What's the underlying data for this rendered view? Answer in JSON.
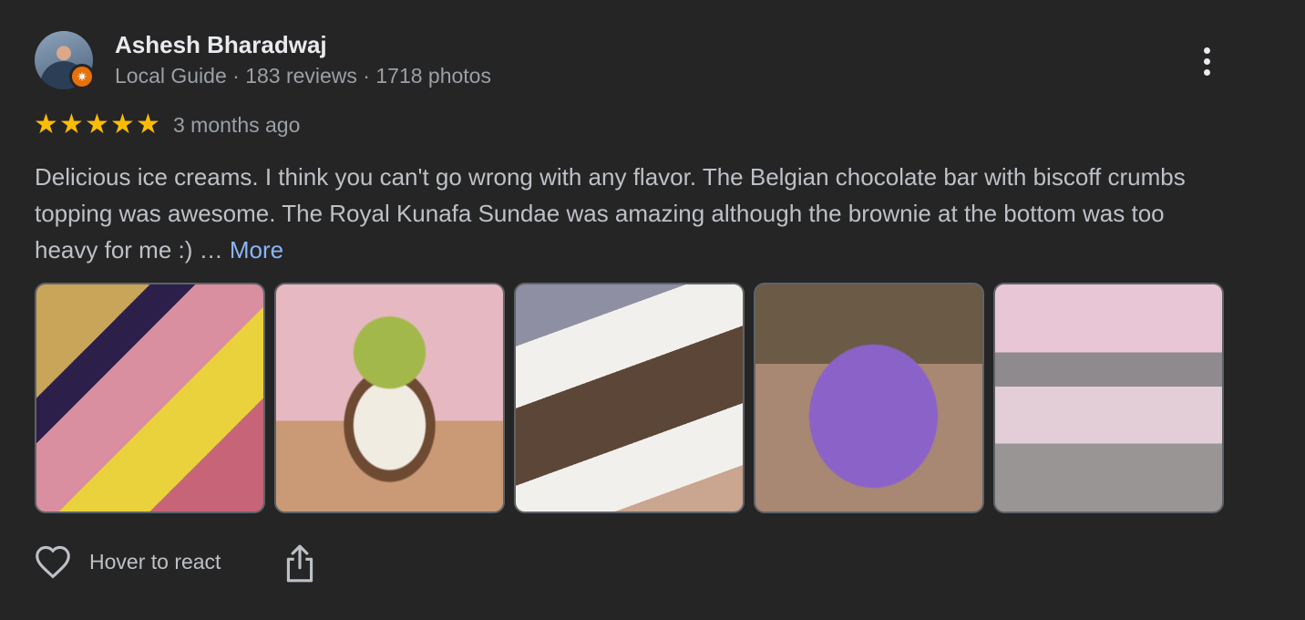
{
  "reviewer": {
    "name": "Ashesh Bharadwaj",
    "meta": "Local Guide · 183 reviews · 1718 photos",
    "badge_icon": "local-guide-star-icon",
    "badge_color": "#e8710a"
  },
  "rating": {
    "stars": 5,
    "star_glyphs": [
      "★",
      "★",
      "★",
      "★",
      "★"
    ],
    "star_color": "#fbbc04",
    "date": "3 months ago"
  },
  "review_text": "Delicious ice creams. I think you can't go wrong with any flavor. The Belgian chocolate bar with biscoff crumbs topping was awesome. The Royal Kunafa Sundae was amazing although the brownie at the bottom was too heavy for me :) …",
  "more_label": "More",
  "more_color": "#8ab4f8",
  "photos": [
    "ice-cream-bar-photo",
    "kunafa-sundae-photo",
    "biscoff-bar-photo",
    "purple-ice-cream-photo",
    "shop-counter-photo"
  ],
  "actions": {
    "react_label": "Hover to react",
    "react_icon": "heart-outline-icon",
    "share_icon": "share-icon"
  },
  "menu_icon": "more-vert-icon"
}
